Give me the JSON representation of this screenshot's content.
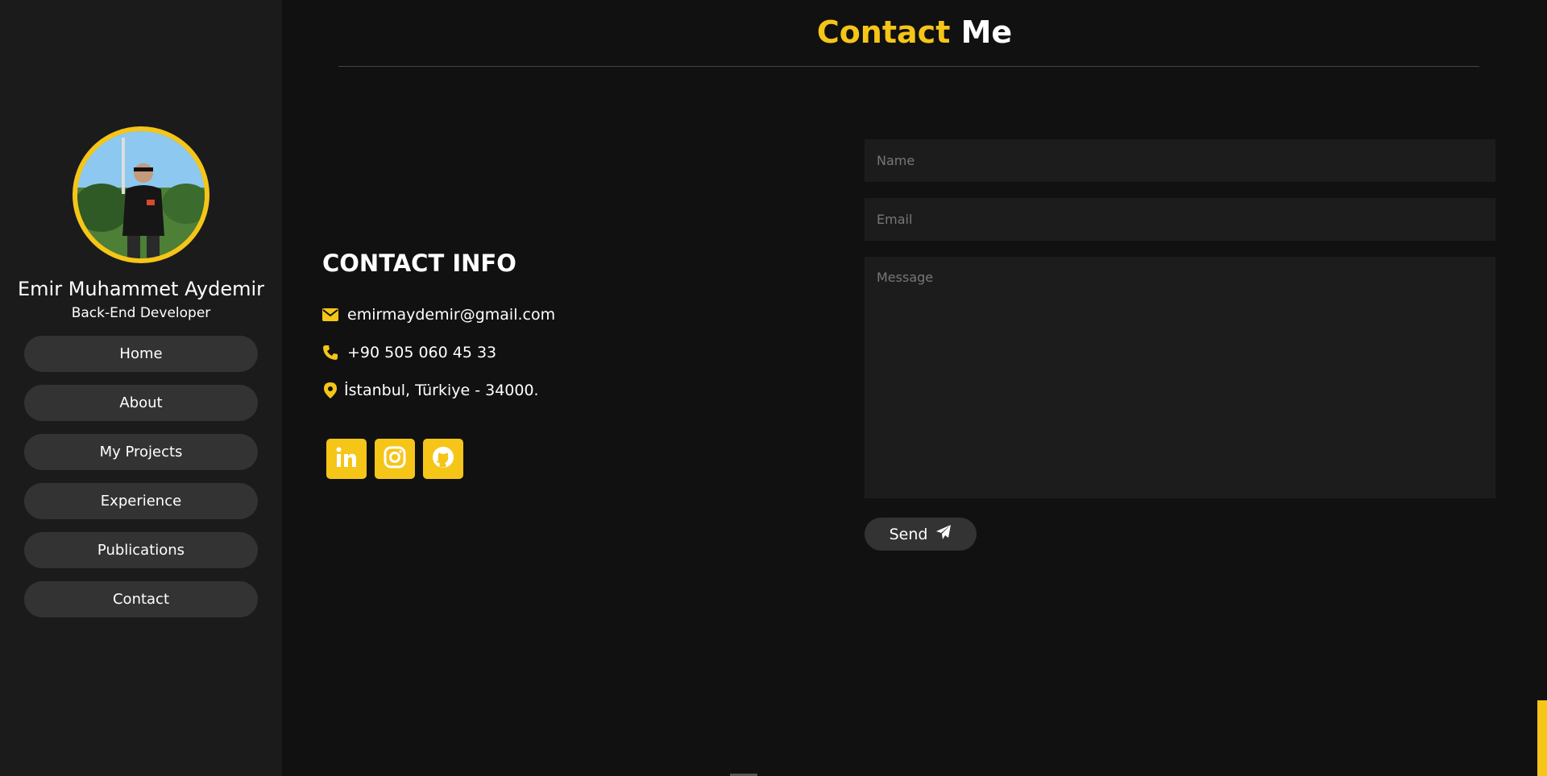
{
  "sidebar": {
    "name": "Emir Muhammet Aydemir",
    "role": "Back-End Developer",
    "nav": [
      "Home",
      "About",
      "My Projects",
      "Experience",
      "Publications",
      "Contact"
    ]
  },
  "header": {
    "title_accent": "Contact",
    "title_rest": "Me"
  },
  "contact_info": {
    "heading": "CONTACT INFO",
    "email": "emirmaydemir@gmail.com",
    "phone": "+90 505 060 45 33",
    "address": "İstanbul, Türkiye - 34000."
  },
  "social_icons": [
    "linkedin-icon",
    "instagram-icon",
    "github-icon"
  ],
  "form": {
    "name_placeholder": "Name",
    "email_placeholder": "Email",
    "message_placeholder": "Message",
    "send_label": "Send"
  },
  "colors": {
    "accent": "#f5c518",
    "background": "#111111",
    "sidebar": "#1b1b1b",
    "button": "#333333"
  }
}
